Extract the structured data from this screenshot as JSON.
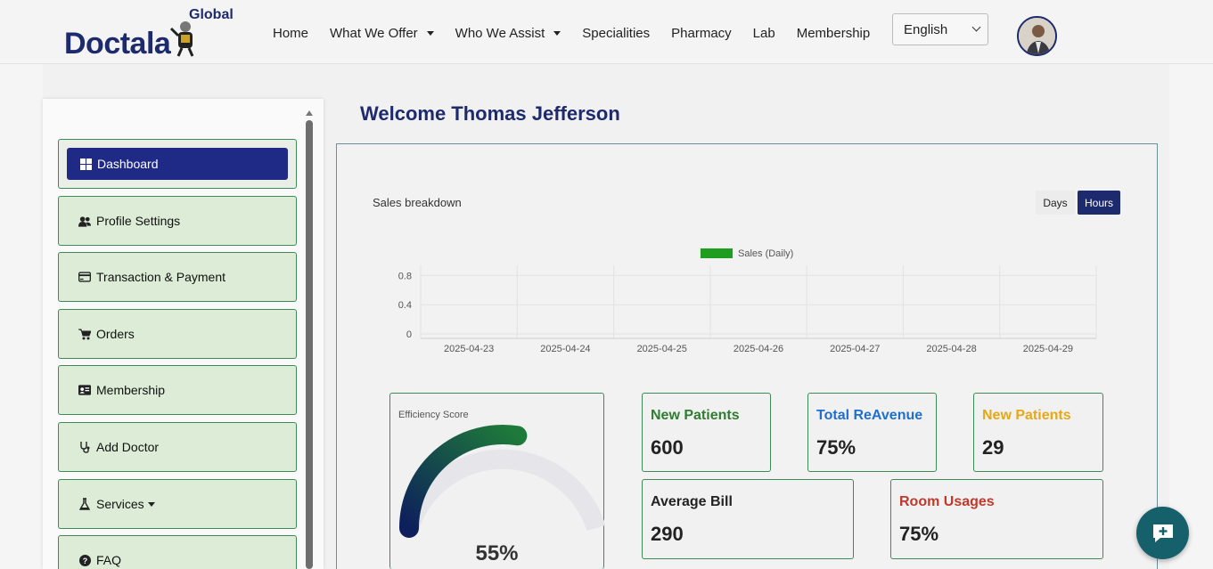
{
  "header": {
    "logo_text": "Doctala",
    "logo_superscript": "Global",
    "nav": [
      {
        "label": "Home",
        "dropdown": false
      },
      {
        "label": "What We Offer",
        "dropdown": true
      },
      {
        "label": "Who We Assist",
        "dropdown": true
      },
      {
        "label": "Specialities",
        "dropdown": false
      },
      {
        "label": "Pharmacy",
        "dropdown": false
      },
      {
        "label": "Lab",
        "dropdown": false
      },
      {
        "label": "Membership",
        "dropdown": false
      }
    ],
    "language": "English"
  },
  "sidebar": {
    "items": [
      {
        "label": "Dashboard",
        "icon": "grid-icon",
        "active": true
      },
      {
        "label": "Profile Settings",
        "icon": "users-icon"
      },
      {
        "label": "Transaction & Payment",
        "icon": "credit-card-icon"
      },
      {
        "label": "Orders",
        "icon": "cart-icon"
      },
      {
        "label": "Membership",
        "icon": "id-card-icon"
      },
      {
        "label": "Add Doctor",
        "icon": "stethoscope-icon"
      },
      {
        "label": "Services",
        "icon": "flask-icon",
        "dropdown": true
      },
      {
        "label": "FAQ",
        "icon": "question-circle-icon"
      }
    ]
  },
  "main": {
    "welcome": "Welcome Thomas Jefferson",
    "sales": {
      "title": "Sales breakdown",
      "tabs": {
        "days": "Days",
        "hours": "Hours",
        "selected": "Hours"
      }
    },
    "cards": {
      "efficiency_label": "Efficiency Score",
      "efficiency_value": "55%",
      "new_patients_title": "New Patients",
      "new_patients_value": "600",
      "revenue_title": "Total ReAvenue",
      "revenue_value": "75%",
      "new_patients2_title": "New Patients",
      "new_patients2_value": "29",
      "avg_bill_title": "Average Bill",
      "avg_bill_value": "290",
      "room_title": "Room Usages",
      "room_value": "75%"
    }
  },
  "colors": {
    "brand": "#1e2a6e",
    "card_border": "#3d8a56",
    "green_title": "#2e7d32",
    "blue_title": "#1f6fd1",
    "yellow_title": "#e6a817",
    "red_title": "#c0392b",
    "fab": "#16606c"
  },
  "chart_data": {
    "type": "bar",
    "categories": [
      "2025-04-23",
      "2025-04-24",
      "2025-04-25",
      "2025-04-26",
      "2025-04-27",
      "2025-04-28",
      "2025-04-29"
    ],
    "series": [
      {
        "name": "Sales (Daily)",
        "values": [
          0,
          0,
          0,
          0,
          0,
          0,
          0
        ],
        "color": "#1f9d1f"
      }
    ],
    "yticks": [
      "0",
      "0.4",
      "0.8"
    ],
    "ylim": [
      0,
      1
    ],
    "legend": "top-center",
    "grid": true
  },
  "gauge": {
    "value_fraction": 0.55
  }
}
